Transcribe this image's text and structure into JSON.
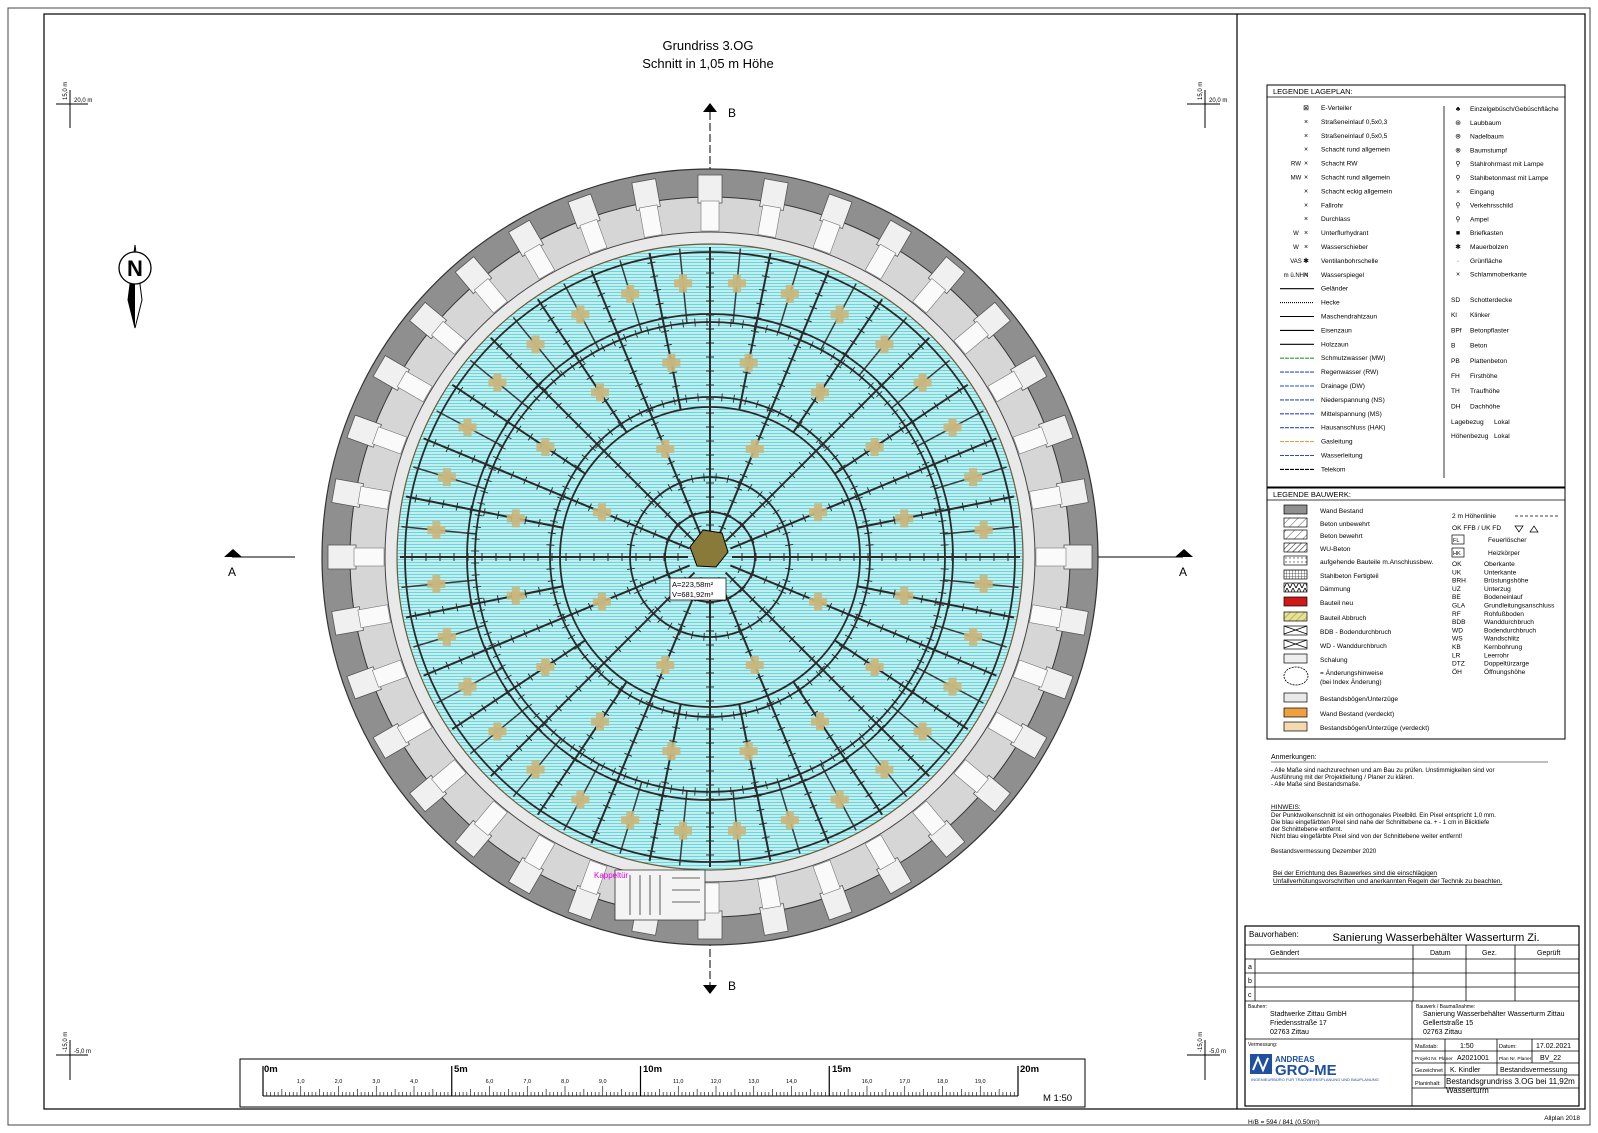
{
  "title": {
    "line1": "Grundriss 3.OG",
    "line2": "Schnitt in 1,05 m Höhe"
  },
  "section_marks": {
    "b_top": "B",
    "b_bottom": "B",
    "a_left": "A",
    "a_right": "A"
  },
  "north": "N",
  "grid_marks": {
    "tl": "20,0 m",
    "tr": "20,0 m",
    "bl": "-5,0 m",
    "br": "-5,0 m",
    "tl_v": "15,0 m",
    "tr_v": "15,0 m",
    "bl_v": "-15,0 m",
    "br_v": "-15,0 m"
  },
  "area": {
    "a": "A=223,58m²",
    "v": "V=681,92m³"
  },
  "kappe_label": "Kappeltür",
  "scale_bar": {
    "major": [
      "0m",
      "5m",
      "10m",
      "15m",
      "20m"
    ],
    "minor_0": [
      "1,0",
      "2,0",
      "3,0",
      "4,0"
    ],
    "minor_5": [
      "6,0",
      "7,0",
      "8,0",
      "9,0"
    ],
    "minor_10": [
      "11,0",
      "12,0",
      "13,0",
      "14,0"
    ],
    "minor_15": [
      "16,0",
      "17,0",
      "18,0",
      "19,0"
    ],
    "ratio": "M 1:50"
  },
  "legend_lageplan": {
    "header": "LEGENDE LAGEPLAN:",
    "left": [
      "E-Verteiler",
      "Straßeneinlauf 0,5x0,3",
      "Straßeneinlauf 0,5x0,5",
      "Schacht rund allgemein",
      "Schacht RW",
      "Schacht rund allgemein",
      "Schacht eckig allgemein",
      "Fallrohr",
      "Durchlass",
      "Unterflurhydrant",
      "Wasserschieber",
      "Ventilanbohrschelle",
      "Wasserspiegel",
      "Geländer",
      "Hecke",
      "Maschendrahtzaun",
      "Eisenzaun",
      "Holzzaun",
      "Schmutzwasser (MW)",
      "Regenwasser (RW)",
      "Drainage (DW)",
      "Niederspannung (NS)",
      "Mittelspannung (MS)",
      "Hausanschluss (HAK)",
      "Gasleitung",
      "Wasserleitung",
      "Telekom"
    ],
    "left_sym": [
      "",
      "",
      "",
      "",
      "RW",
      "MW",
      "",
      "",
      "",
      "W",
      "W",
      "VAS",
      "m ü.NHN"
    ],
    "right": [
      "Einzelgebüsch/Gebüschfläche",
      "Laubbaum",
      "Nadelbaum",
      "Baumstumpf",
      "Stahlrohrmast mit Lampe",
      "Stahlbetonmast mit Lampe",
      "Eingang",
      "Verkehrsschild",
      "Ampel",
      "Briefkasten",
      "Mauerbolzen",
      "Grünfläche",
      "Schlammoberkante"
    ],
    "abbr": [
      [
        "SD",
        "Schotterdecke"
      ],
      [
        "Kl",
        "Klinker"
      ],
      [
        "BPf",
        "Betonpflaster"
      ],
      [
        "B",
        "Beton"
      ],
      [
        "PB",
        "Plattenbeton"
      ],
      [
        "FH",
        "Firsthöhe"
      ],
      [
        "TH",
        "Traufhöhe"
      ],
      [
        "DH",
        "Dachhöhe"
      ]
    ],
    "bezug": [
      [
        "Lagebezug",
        "Lokal"
      ],
      [
        "Höhenbezug",
        "Lokal"
      ]
    ]
  },
  "legend_bauwerk": {
    "header": "LEGENDE BAUWERK:",
    "left": [
      "Wand Bestand",
      "Beton unbewehrt",
      "Beton bewehrt",
      "WU-Beton",
      "aufgehende Bauteile m.Anschlussbew.",
      "Stahlbeton Fertigteil",
      "Dämmung",
      "Bauteil neu",
      "Bauteil Abbruch",
      "BDB - Bodendurchbruch",
      "WD - Wanddurchbruch",
      "Schalung",
      "= Änderungshinweise",
      "(bei Index Änderung)",
      "Bestandsbögen/Unterzüge",
      "Wand Bestand (verdeckt)",
      "Bestandsbögen/Unterzüge (verdeckt)"
    ],
    "right_top": [
      "2 m Höhenlinie",
      "OK FFB / UK FD",
      "Feuerlöscher",
      "Heizkörper"
    ],
    "fl": "FL",
    "hk": "HK",
    "abbr": [
      [
        "OK",
        "Oberkante"
      ],
      [
        "UK",
        "Unterkante"
      ],
      [
        "BRH",
        "Brüstungshöhe"
      ],
      [
        "UZ",
        "Unterzug"
      ],
      [
        "BE",
        "Bodeneinlauf"
      ],
      [
        "GLA",
        "Grundleitungsanschluss"
      ],
      [
        "RF",
        "Rohfußboden"
      ],
      [
        "BDB",
        "Wanddurchbruch"
      ],
      [
        "WD",
        "Bodendurchbruch"
      ],
      [
        "WS",
        "Wandschlitz"
      ],
      [
        "KB",
        "Kernbohrung"
      ],
      [
        "LR",
        "Leerrohr"
      ],
      [
        "DTZ",
        "Doppeltürzarge"
      ],
      [
        "ÖH",
        "Öffnungshöhe"
      ]
    ]
  },
  "notes": {
    "header": "Anmerkungen:",
    "lines": [
      "- Alle Maße sind nachzurechnen und am Bau zu prüfen. Unstimmigkeiten sind vor",
      "  Ausführung mit der Projektleitung / Planer zu klären.",
      "- Alle Maße sind Bestandsmaße."
    ],
    "hinweis_h": "HINWEIS:",
    "hinweis": [
      "Der Punktwolkenschnitt ist ein orthogonales Pixelbild. Ein Pixel entspricht 1,0 mm.",
      "Die blau eingefärbten Pixel sind nahe der Schnittebene ca. + - 1 cm in Blicktiefe",
      "der Schnittebene entfernt.",
      "Nicht blau eingefärbte Pixel sind von der Schnittebene weiter entfernt!"
    ],
    "bestand": "Bestandsvermessung Dezember 2020",
    "warn": [
      "Bei der Errichtung des Bauwerkes sind die einschlägigen",
      "Unfallverhütungsvorschriften und anerkannten Regeln der Technik zu beachten."
    ]
  },
  "titleblock": {
    "bauvorhaben_l": "Bauvorhaben:",
    "bauvorhaben": "Sanierung Wasserbehälter Wasserturm Zi.",
    "cols": [
      "Geändert",
      "Datum",
      "Gez.",
      "Geprüft"
    ],
    "rows": [
      "a",
      "b",
      "c"
    ],
    "bauherr_l": "Bauherr:",
    "bauherr": [
      "Stadtwerke Zittau GmbH",
      "Friedensstraße 17",
      "02763 Zittau"
    ],
    "bauwerk_l": "Bauwerk / Baumaßnahme:",
    "bauwerk": [
      "Sanierung Wasserbehälter Wasserturm Zittau",
      "Gellertstraße 15",
      "02763 Zittau"
    ],
    "verm_l": "Vermessung:",
    "company1": "ANDREAS",
    "company2": "GRO-ME",
    "company_sub": "INGENIEURBÜRO FÜR TRAGWERKSPLANUNG UND BAUPLANUNG",
    "massstab_l": "Maßstab:",
    "massstab": "1:50",
    "datum_l": "Datum:",
    "datum": "17.02.2021",
    "projekt_l": "Projekt Nr. Planer",
    "projekt": "A2021001",
    "plan_l": "Plan Nr. Planer",
    "plan": "BV_22",
    "gez_l": "Gezeichnet",
    "gez": "K. Kindler",
    "art": "Bestandsvermessung",
    "planinhalt_l": "Planinhalt:",
    "planinhalt": [
      "Bestandsgrundriss 3.OG bei 11,92m",
      "Wasserturm"
    ]
  },
  "footer": {
    "format": "H/B = 594 / 841 (0.50m²)",
    "software": "Allplan 2018"
  }
}
